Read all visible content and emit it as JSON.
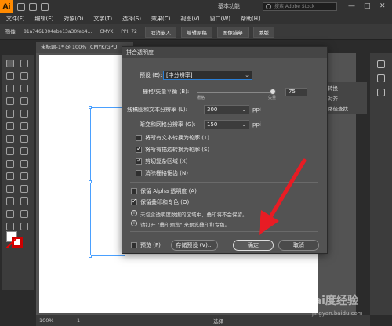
{
  "app": {
    "logo": "Ai",
    "workspace": "基本功能",
    "search_placeholder": "搜索 Adobe Stock",
    "window_controls": [
      "—",
      "□",
      "✕"
    ]
  },
  "menu": [
    "文件(F)",
    "编辑(E)",
    "对象(O)",
    "文字(T)",
    "选择(S)",
    "效果(C)",
    "视图(V)",
    "窗口(W)",
    "帮助(H)"
  ],
  "control_bar": {
    "label": "图像",
    "filename": "81a7461304ebe13a30feb4...",
    "color_mode": "CMYK",
    "ppi": "PPI: 72",
    "btn_embed": "取消嵌入",
    "btn_edit": "编辑原稿",
    "btn_trace": "图像描摹",
    "btn_mask": "蒙版"
  },
  "doc_tab": "未标题-1* @ 100% (CMYK/GPU",
  "right_panel": [
    "转换",
    "对齐",
    "路径查找"
  ],
  "status": {
    "zoom": "100%",
    "page": "1",
    "mode": "选择"
  },
  "dialog": {
    "title": "拼合透明度",
    "preset_label": "预设 (E):",
    "preset_value": "[中分辨率]",
    "raster_vector_label": "栅格/矢量平衡 (B):",
    "raster_small": "栅格",
    "vector_small": "矢量",
    "balance_value": "75",
    "lineart_label": "线稿图和文本分辨率 (L):",
    "lineart_value": "300",
    "gradient_label": "渐变和网格分辨率 (G):",
    "gradient_value": "150",
    "unit": "ppi",
    "checkboxes": [
      {
        "label": "将所有文本转换为轮廓 (T)",
        "checked": false
      },
      {
        "label": "将所有描边转换为轮廓 (S)",
        "checked": true
      },
      {
        "label": "剪切复杂区域 (X)",
        "checked": true
      },
      {
        "label": "消除栅格锯齿 (N)",
        "checked": false
      }
    ],
    "preserve_alpha": {
      "label": "保留 Alpha 透明度 (A)",
      "checked": false
    },
    "preserve_overprint": {
      "label": "保留叠印和专色 (O)",
      "checked": true
    },
    "info1": "未包含透明度数据的区域中，叠印将不会保留。",
    "info2": "请打开 \"叠印预览\" 来预览叠印和专色。",
    "preview_label": "预览 (P)",
    "btn_save_preset": "存储预设 (V)...",
    "btn_ok": "确定",
    "btn_cancel": "取消"
  },
  "watermark": {
    "main": "Bai度经验",
    "sub": "jingyan.baidu.com"
  },
  "colors": {
    "accent": "#ff8a00",
    "arrow": "#e81c24",
    "dialog_bg": "#535353",
    "selection": "#4aa0ff"
  }
}
